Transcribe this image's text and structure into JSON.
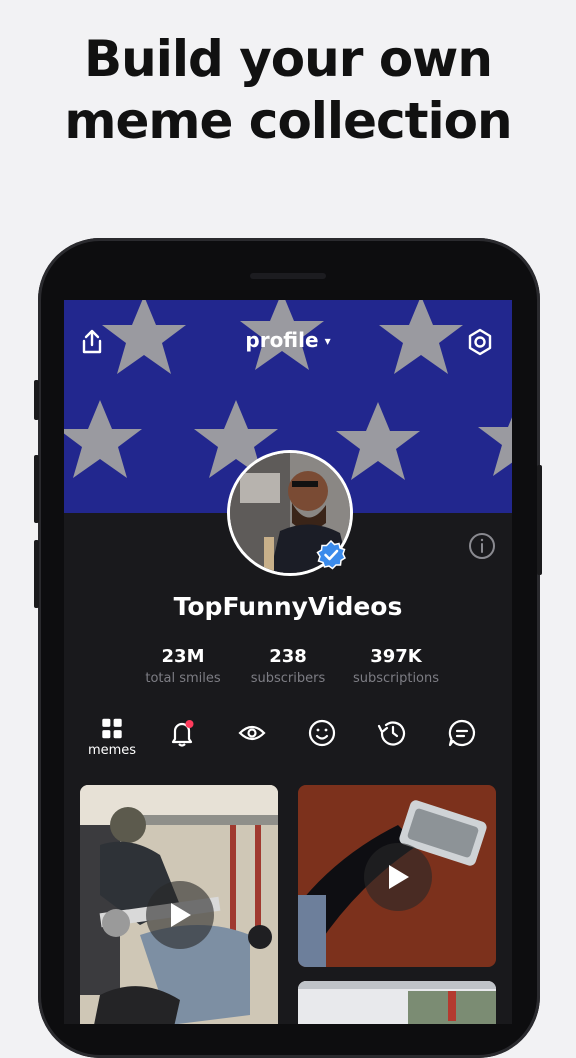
{
  "promo": {
    "headline_line1": "Build your own",
    "headline_line2": "meme collection"
  },
  "header": {
    "title": "profile",
    "share_icon": "share-icon",
    "settings_icon": "settings-icon"
  },
  "profile": {
    "username": "TopFunnyVideos",
    "verified": true,
    "stats": [
      {
        "value": "23M",
        "label": "total smiles"
      },
      {
        "value": "238",
        "label": "subscribers"
      },
      {
        "value": "397K",
        "label": "subscriptions"
      }
    ]
  },
  "tabs": [
    {
      "icon": "grid-icon",
      "label": "memes",
      "active": true
    },
    {
      "icon": "bell-icon",
      "label": "",
      "badge": true
    },
    {
      "icon": "eye-icon",
      "label": ""
    },
    {
      "icon": "smile-icon",
      "label": ""
    },
    {
      "icon": "history-icon",
      "label": ""
    },
    {
      "icon": "comment-icon",
      "label": ""
    }
  ],
  "colors": {
    "banner": "#22278e",
    "star": "#9a9aa0",
    "background": "#19191c",
    "verified": "#3b8beb",
    "badge": "#ff3b5c"
  }
}
